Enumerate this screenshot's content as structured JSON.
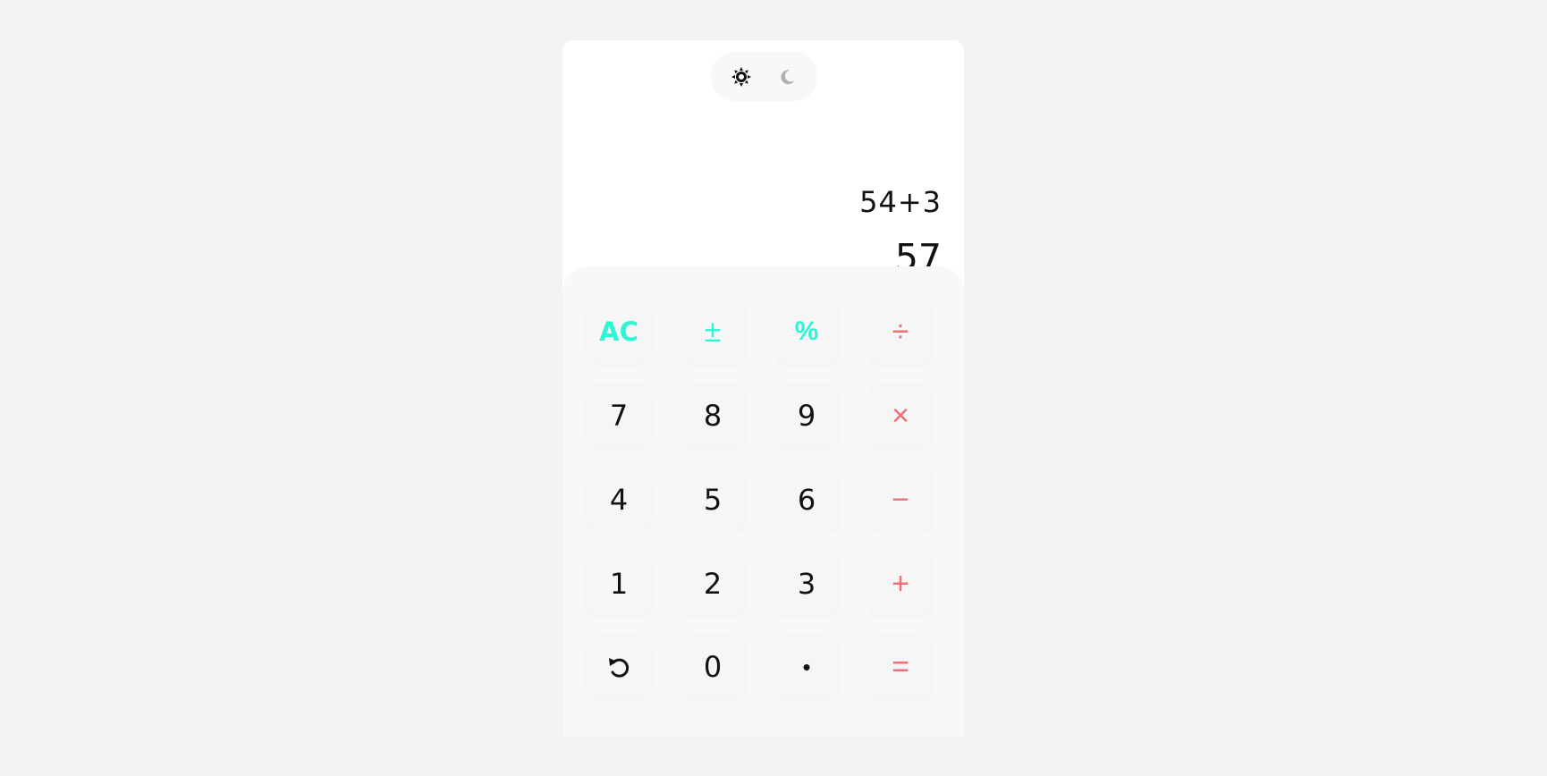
{
  "theme": {
    "light_icon": "sun-icon",
    "dark_icon": "moon-icon",
    "active": "light"
  },
  "display": {
    "expression": "54+3",
    "result": "57"
  },
  "keys": {
    "clear": "AC",
    "plus_minus": "±",
    "percent": "%",
    "divide": "÷",
    "seven": "7",
    "eight": "8",
    "nine": "9",
    "multiply": "×",
    "four": "4",
    "five": "5",
    "six": "6",
    "minus": "−",
    "one": "1",
    "two": "2",
    "three": "3",
    "plus": "+",
    "undo_icon": "undo-icon",
    "zero": "0",
    "decimal": "•",
    "equals": "="
  },
  "colors": {
    "background": "#f4f2f3",
    "function_accent": "#2ef5d3",
    "operator_accent": "#f06f72",
    "text": "#111111"
  }
}
